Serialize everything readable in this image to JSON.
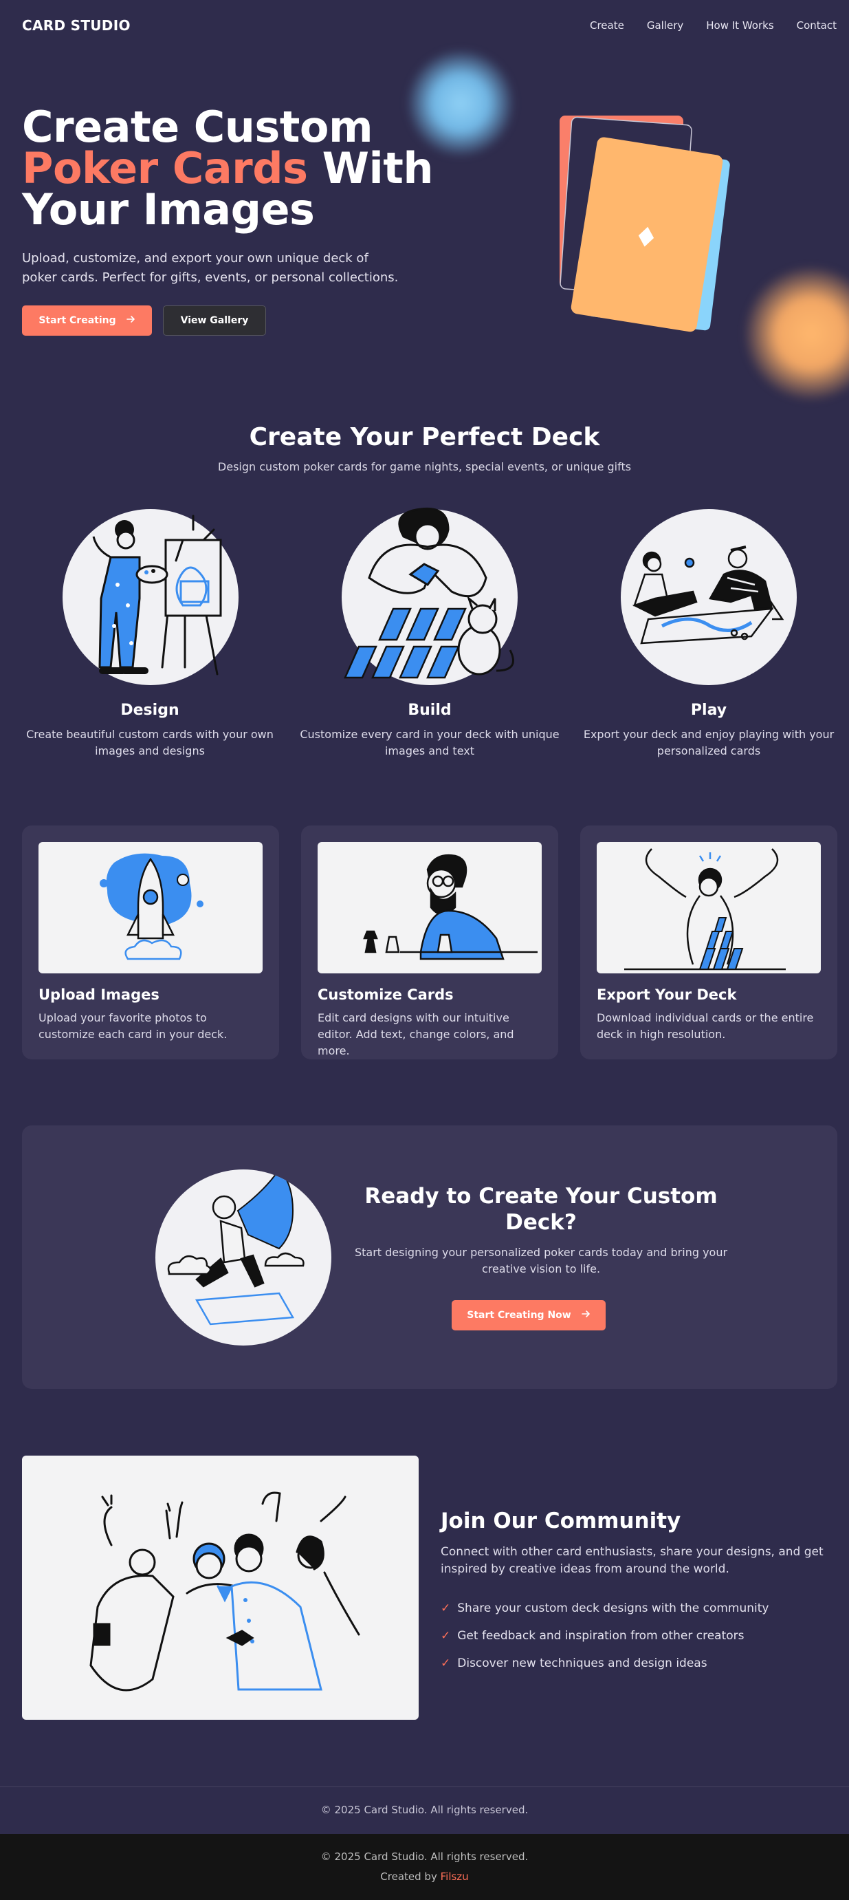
{
  "nav": {
    "logo": "CARD STUDIO",
    "links": [
      "Create",
      "Gallery",
      "How It Works",
      "Contact"
    ]
  },
  "hero": {
    "title_line1": "Create Custom",
    "title_accent": "Poker Cards",
    "title_line2_rest": " With",
    "title_line3": "Your Images",
    "subtitle": "Upload, customize, and export your own unique deck of poker cards. Perfect for gifts, events, or personal collections.",
    "primary_button": "Start Creating",
    "secondary_button": "View Gallery",
    "card_symbol": "♦"
  },
  "deck": {
    "title": "Create Your Perfect Deck",
    "subtitle": "Design custom poker cards for game nights, special events, or unique gifts",
    "steps": [
      {
        "title": "Design",
        "text": "Create beautiful custom cards with your own images and designs"
      },
      {
        "title": "Build",
        "text": "Customize every card in your deck with unique images and text"
      },
      {
        "title": "Play",
        "text": "Export your deck and enjoy playing with your personalized cards"
      }
    ]
  },
  "features": [
    {
      "title": "Upload Images",
      "text": "Upload your favorite photos to customize each card in your deck."
    },
    {
      "title": "Customize Cards",
      "text": "Edit card designs with our intuitive editor. Add text, change colors, and more."
    },
    {
      "title": "Export Your Deck",
      "text": "Download individual cards or the entire deck in high resolution."
    }
  ],
  "cta": {
    "title": "Ready to Create Your Custom Deck?",
    "text": "Start designing your personalized poker cards today and bring your creative vision to life.",
    "button": "Start Creating Now"
  },
  "community": {
    "title": "Join Our Community",
    "text": "Connect with other card enthusiasts, share your designs, and get inspired by creative ideas from around the world.",
    "check_mark": "✓",
    "items": [
      "Share your custom deck designs with the community",
      "Get feedback and inspiration from other creators",
      "Discover new techniques and design ideas"
    ]
  },
  "footer": {
    "copyright": "© 2025 Card Studio. All rights reserved.",
    "copyright2": "© 2025 Card Studio. All rights reserved.",
    "created_by_prefix": "Created by ",
    "created_by_name": "Filszu"
  },
  "colors": {
    "background": "#2f2c4c",
    "accent": "#fd7a63",
    "card_surface": "#3b3757",
    "illustration_blue": "#3b8ef0",
    "card_orange": "#ffb76d",
    "card_salmon": "#fa7f6a",
    "card_sky": "#8ad4fb"
  },
  "icons": {
    "button_arrow": "arrow-right-icon",
    "list_check": "check-icon"
  }
}
